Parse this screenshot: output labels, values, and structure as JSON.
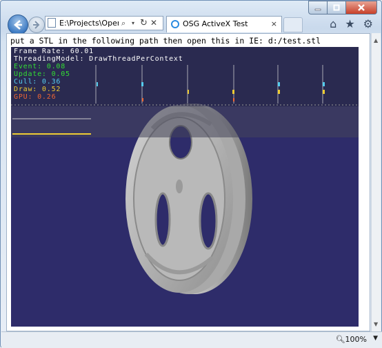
{
  "browser": {
    "address": "E:\\Projects\\OpenScene",
    "address_search_icon": "search-icon",
    "tab_title": "OSG ActiveX Test",
    "tab_close": "×",
    "zoom_label": "100%"
  },
  "page": {
    "instruction": "put a STL in the following path then open this in IE: d:/test.stl"
  },
  "stats": {
    "frame_rate": "Frame Rate: 60.01",
    "threading": "ThreadingModel: DrawThreadPerContext",
    "event": "Event: 0.08",
    "update": "Update: 0.05",
    "cull": "Cull: 0.36",
    "draw": "Draw: 0.52",
    "gpu": "GPU: 0.26",
    "colors": {
      "frame": "#ffffff",
      "event": "#33dd33",
      "update": "#33dd33",
      "cull": "#55ccee",
      "draw": "#eecc33",
      "gpu": "#ee6633"
    }
  },
  "colors": {
    "viewer_bg": "#2e2c6a",
    "tab_icon": "#2a8be0"
  }
}
